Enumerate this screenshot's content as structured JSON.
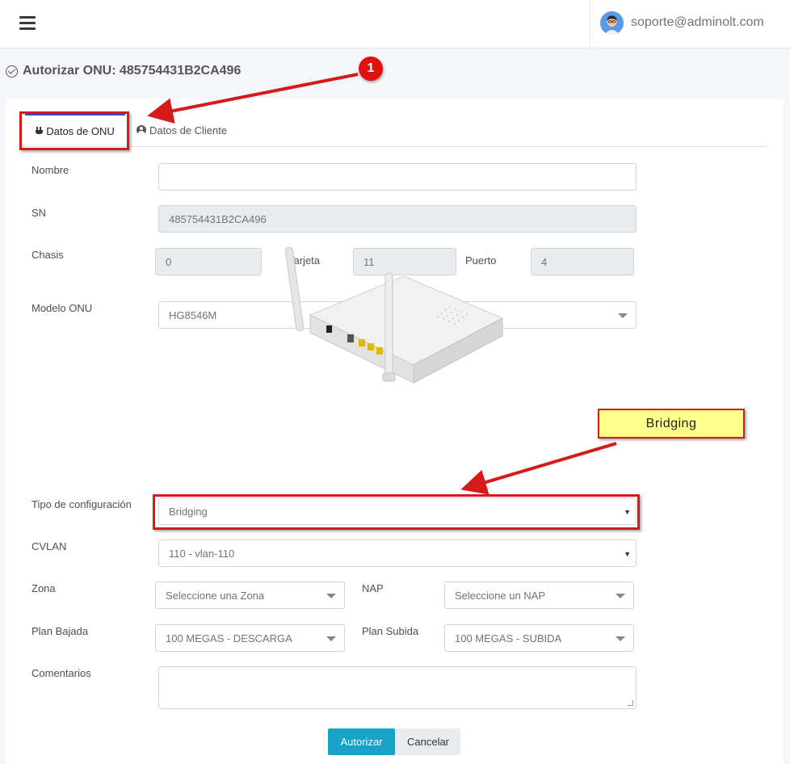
{
  "header": {
    "user_email": "soporte@adminolt.com"
  },
  "page": {
    "title": "Autorizar ONU: 485754431B2CA496"
  },
  "tabs": [
    {
      "label": "Datos de ONU",
      "active": true
    },
    {
      "label": "Datos de Cliente",
      "active": false
    }
  ],
  "form": {
    "nombre": {
      "label": "Nombre",
      "value": ""
    },
    "sn": {
      "label": "SN",
      "value": "485754431B2CA496"
    },
    "chasis": {
      "label": "Chasis",
      "value": "0"
    },
    "tarjeta": {
      "label": "Tarjeta",
      "value": "11"
    },
    "puerto": {
      "label": "Puerto",
      "value": "4"
    },
    "modelo": {
      "label": "Modelo ONU",
      "value": "HG8546M"
    },
    "tipo_config": {
      "label": "Tipo de configuración",
      "value": "Bridging"
    },
    "cvlan": {
      "label": "CVLAN",
      "value": "110 - vlan-110"
    },
    "zona": {
      "label": "Zona",
      "value": "Seleccione una Zona"
    },
    "nap": {
      "label": "NAP",
      "value": "Seleccione un NAP"
    },
    "plan_bajada": {
      "label": "Plan Bajada",
      "value": "100 MEGAS - DESCARGA"
    },
    "plan_subida": {
      "label": "Plan Subida",
      "value": "100 MEGAS - SUBIDA"
    },
    "comentarios": {
      "label": "Comentarios",
      "value": ""
    }
  },
  "buttons": {
    "autorizar": "Autorizar",
    "cancelar": "Cancelar"
  },
  "annotations": {
    "step_number": "1",
    "callout": "Bridging"
  },
  "colors": {
    "accent": "#17a2c8",
    "tab_border": "#2f4bbf",
    "highlight": "#d61a1a",
    "callout_bg": "#ffff8a"
  },
  "icons": [
    "hamburger-icon",
    "avatar",
    "check-circle-icon",
    "plug-icon",
    "user-circle-icon",
    "chevron-down-icon"
  ]
}
